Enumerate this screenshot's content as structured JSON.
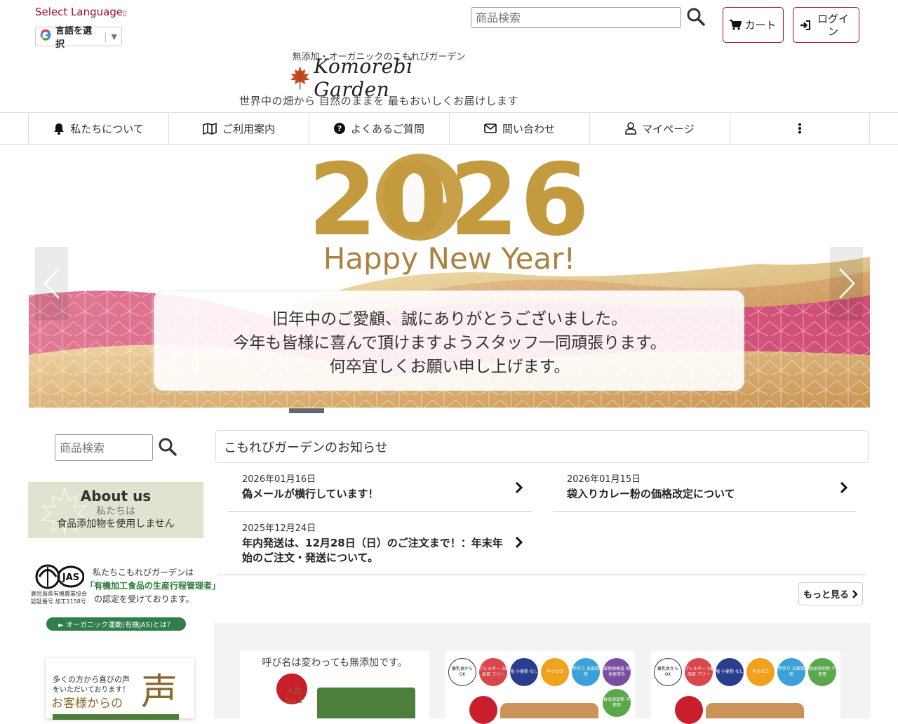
{
  "header": {
    "select_language_link": "Select Language",
    "google_translate_label": "言語を選択",
    "search_placeholder": "商品検索",
    "cart_label": "カート",
    "login_label": "ログイン",
    "tagline_top": "無添加・オーガニックのこもれびガーデン",
    "logo_text": "Komorebi Garden",
    "tagline_bottom": "世界中の畑から 自然のままを 最もおいしくお届けします"
  },
  "nav": {
    "items": [
      {
        "label": "私たちについて",
        "icon": "bell-icon"
      },
      {
        "label": "ご利用案内",
        "icon": "map-icon"
      },
      {
        "label": "よくあるご質問",
        "icon": "question-circle-icon"
      },
      {
        "label": "問い合わせ",
        "icon": "envelope-icon"
      },
      {
        "label": "マイページ",
        "icon": "user-icon"
      },
      {
        "label": "",
        "icon": "more-vertical-icon"
      }
    ]
  },
  "banner": {
    "year": "2026",
    "greeting": "Happy New Year!",
    "message_lines": [
      "旧年中のご愛顧、誠にありがとうございました。",
      "今年も皆様に喜んで頂けますようスタッフ一同頑張ります。",
      "何卒宜しくお願い申し上げます。"
    ],
    "accent_gold": "#c49a3e",
    "accent_pink": "#d9587d"
  },
  "sidebar": {
    "search_placeholder": "商品検索",
    "about": {
      "title": "About us",
      "subtitle": "私たちは",
      "text": "食品添加物を使用しません"
    },
    "jas": {
      "logo_text": "JAS",
      "cert_line1": "鹿児島県有機農業協会",
      "cert_line2": "認証番号 加工1158号",
      "line1": "私たちこもれびガーデンは",
      "line2": "「有機加工食品の生産行程管理者」",
      "line3": "の認定を受けております。",
      "button_label": "► オーガニック運動(有機JAS)とは？"
    },
    "voice": {
      "line1": "多くの方から喜びの声",
      "line2": "をいただいております！",
      "line3": "お客様からの",
      "big": "声"
    }
  },
  "news": {
    "heading": "こもれびガーデンのお知らせ",
    "items": [
      {
        "date": "2026年01月16日",
        "title": "偽メールが横行しています！"
      },
      {
        "date": "2026年01月15日",
        "title": "袋入りカレー粉の価格改定について"
      },
      {
        "date": "2025年12月24日",
        "title_line1": "年内発送は、12月28日（日）のご注文まで！：年末年",
        "title_line2": "始のご注文・発送について。"
      }
    ],
    "more_label": "もっと見る"
  },
  "products": {
    "card1_text": "呼び名は変わっても無添加です。",
    "card1_badge": "人気 No.1",
    "badges_a": [
      "離乳食から OK",
      "アレルギー 28品目 フリー",
      "塩 小麦粉 なし",
      "辛さゼロ",
      "手作り 自家焙煎",
      "放射線検査 国体実済み",
      "食品添加物 不使用"
    ],
    "badges_b": [
      "離乳食から OK",
      "アレルギー 28品目 フリー",
      "塩 小麦粉 なし",
      "辛さゼロ",
      "手作り 自家焙煎",
      "食品添加物 不使用"
    ]
  }
}
